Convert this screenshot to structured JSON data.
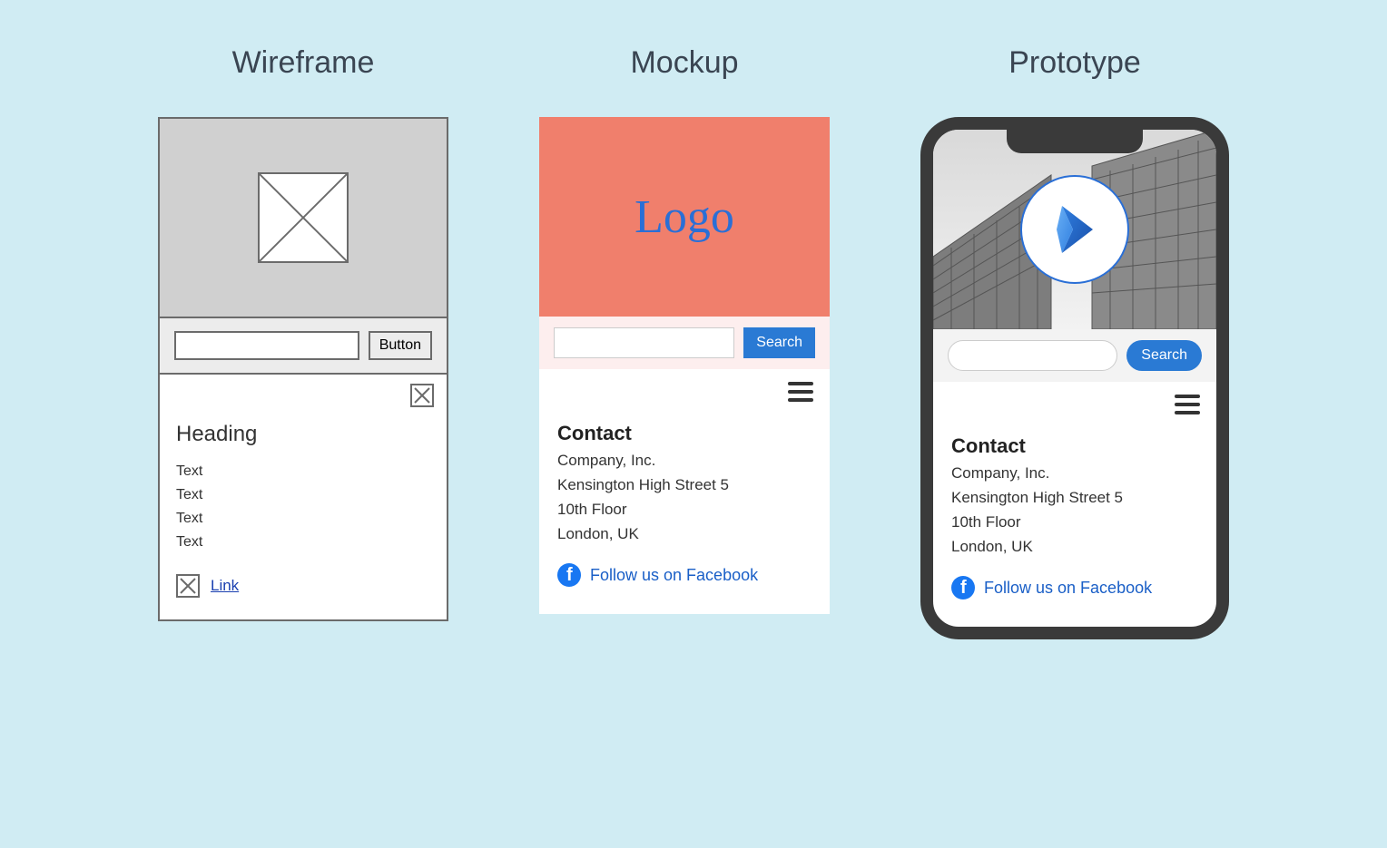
{
  "titles": {
    "wireframe": "Wireframe",
    "mockup": "Mockup",
    "prototype": "Prototype"
  },
  "wireframe": {
    "button": "Button",
    "heading": "Heading",
    "texts": [
      "Text",
      "Text",
      "Text",
      "Text"
    ],
    "link": "Link"
  },
  "mockup": {
    "logo": "Logo",
    "search_btn": "Search",
    "heading": "Contact",
    "lines": [
      "Company, Inc.",
      "Kensington High Street 5",
      "10th Floor",
      "London, UK"
    ],
    "fb": "Follow us on Facebook"
  },
  "prototype": {
    "search_btn": "Search",
    "heading": "Contact",
    "lines": [
      "Company, Inc.",
      "Kensington High Street 5",
      "10th Floor",
      "London, UK"
    ],
    "fb": "Follow us on Facebook"
  }
}
